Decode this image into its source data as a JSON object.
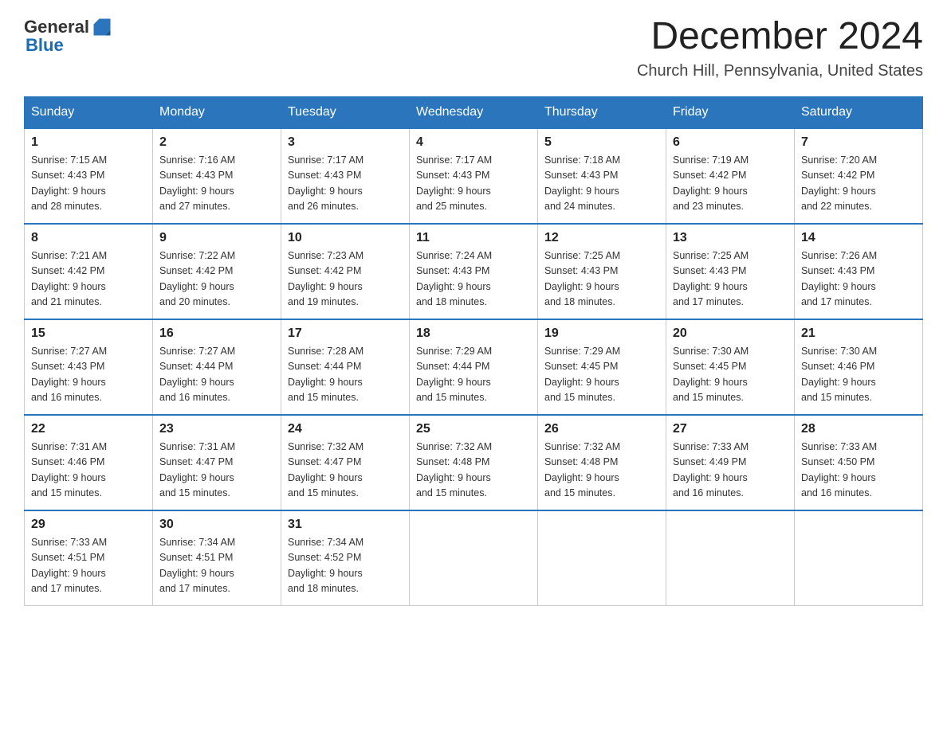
{
  "header": {
    "logo_general": "General",
    "logo_blue": "Blue",
    "title": "December 2024",
    "subtitle": "Church Hill, Pennsylvania, United States"
  },
  "days_of_week": [
    "Sunday",
    "Monday",
    "Tuesday",
    "Wednesday",
    "Thursday",
    "Friday",
    "Saturday"
  ],
  "weeks": [
    [
      {
        "day": "1",
        "sunrise": "7:15 AM",
        "sunset": "4:43 PM",
        "daylight": "9 hours and 28 minutes."
      },
      {
        "day": "2",
        "sunrise": "7:16 AM",
        "sunset": "4:43 PM",
        "daylight": "9 hours and 27 minutes."
      },
      {
        "day": "3",
        "sunrise": "7:17 AM",
        "sunset": "4:43 PM",
        "daylight": "9 hours and 26 minutes."
      },
      {
        "day": "4",
        "sunrise": "7:17 AM",
        "sunset": "4:43 PM",
        "daylight": "9 hours and 25 minutes."
      },
      {
        "day": "5",
        "sunrise": "7:18 AM",
        "sunset": "4:43 PM",
        "daylight": "9 hours and 24 minutes."
      },
      {
        "day": "6",
        "sunrise": "7:19 AM",
        "sunset": "4:42 PM",
        "daylight": "9 hours and 23 minutes."
      },
      {
        "day": "7",
        "sunrise": "7:20 AM",
        "sunset": "4:42 PM",
        "daylight": "9 hours and 22 minutes."
      }
    ],
    [
      {
        "day": "8",
        "sunrise": "7:21 AM",
        "sunset": "4:42 PM",
        "daylight": "9 hours and 21 minutes."
      },
      {
        "day": "9",
        "sunrise": "7:22 AM",
        "sunset": "4:42 PM",
        "daylight": "9 hours and 20 minutes."
      },
      {
        "day": "10",
        "sunrise": "7:23 AM",
        "sunset": "4:42 PM",
        "daylight": "9 hours and 19 minutes."
      },
      {
        "day": "11",
        "sunrise": "7:24 AM",
        "sunset": "4:43 PM",
        "daylight": "9 hours and 18 minutes."
      },
      {
        "day": "12",
        "sunrise": "7:25 AM",
        "sunset": "4:43 PM",
        "daylight": "9 hours and 18 minutes."
      },
      {
        "day": "13",
        "sunrise": "7:25 AM",
        "sunset": "4:43 PM",
        "daylight": "9 hours and 17 minutes."
      },
      {
        "day": "14",
        "sunrise": "7:26 AM",
        "sunset": "4:43 PM",
        "daylight": "9 hours and 17 minutes."
      }
    ],
    [
      {
        "day": "15",
        "sunrise": "7:27 AM",
        "sunset": "4:43 PM",
        "daylight": "9 hours and 16 minutes."
      },
      {
        "day": "16",
        "sunrise": "7:27 AM",
        "sunset": "4:44 PM",
        "daylight": "9 hours and 16 minutes."
      },
      {
        "day": "17",
        "sunrise": "7:28 AM",
        "sunset": "4:44 PM",
        "daylight": "9 hours and 15 minutes."
      },
      {
        "day": "18",
        "sunrise": "7:29 AM",
        "sunset": "4:44 PM",
        "daylight": "9 hours and 15 minutes."
      },
      {
        "day": "19",
        "sunrise": "7:29 AM",
        "sunset": "4:45 PM",
        "daylight": "9 hours and 15 minutes."
      },
      {
        "day": "20",
        "sunrise": "7:30 AM",
        "sunset": "4:45 PM",
        "daylight": "9 hours and 15 minutes."
      },
      {
        "day": "21",
        "sunrise": "7:30 AM",
        "sunset": "4:46 PM",
        "daylight": "9 hours and 15 minutes."
      }
    ],
    [
      {
        "day": "22",
        "sunrise": "7:31 AM",
        "sunset": "4:46 PM",
        "daylight": "9 hours and 15 minutes."
      },
      {
        "day": "23",
        "sunrise": "7:31 AM",
        "sunset": "4:47 PM",
        "daylight": "9 hours and 15 minutes."
      },
      {
        "day": "24",
        "sunrise": "7:32 AM",
        "sunset": "4:47 PM",
        "daylight": "9 hours and 15 minutes."
      },
      {
        "day": "25",
        "sunrise": "7:32 AM",
        "sunset": "4:48 PM",
        "daylight": "9 hours and 15 minutes."
      },
      {
        "day": "26",
        "sunrise": "7:32 AM",
        "sunset": "4:48 PM",
        "daylight": "9 hours and 15 minutes."
      },
      {
        "day": "27",
        "sunrise": "7:33 AM",
        "sunset": "4:49 PM",
        "daylight": "9 hours and 16 minutes."
      },
      {
        "day": "28",
        "sunrise": "7:33 AM",
        "sunset": "4:50 PM",
        "daylight": "9 hours and 16 minutes."
      }
    ],
    [
      {
        "day": "29",
        "sunrise": "7:33 AM",
        "sunset": "4:51 PM",
        "daylight": "9 hours and 17 minutes."
      },
      {
        "day": "30",
        "sunrise": "7:34 AM",
        "sunset": "4:51 PM",
        "daylight": "9 hours and 17 minutes."
      },
      {
        "day": "31",
        "sunrise": "7:34 AM",
        "sunset": "4:52 PM",
        "daylight": "9 hours and 18 minutes."
      },
      null,
      null,
      null,
      null
    ]
  ],
  "labels": {
    "sunrise": "Sunrise:",
    "sunset": "Sunset:",
    "daylight": "Daylight:"
  }
}
